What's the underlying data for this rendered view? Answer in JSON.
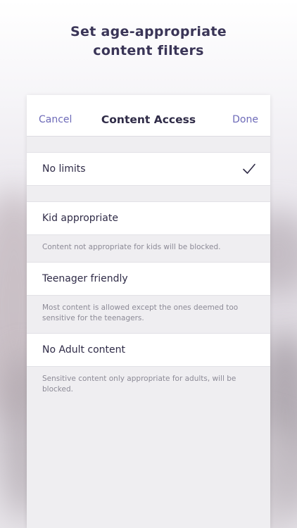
{
  "headline": {
    "line1": "Set age-appropriate",
    "line2": "content filters"
  },
  "navbar": {
    "cancel_label": "Cancel",
    "title": "Content Access",
    "done_label": "Done"
  },
  "options": [
    {
      "label": "No limits",
      "selected": true,
      "description": ""
    },
    {
      "label": "Kid appropriate",
      "selected": false,
      "description": "Content not appropriate for kids will be blocked."
    },
    {
      "label": "Teenager friendly",
      "selected": false,
      "description": "Most content is allowed except the ones deemed too sensitive for the teenagers."
    },
    {
      "label": "No Adult content",
      "selected": false,
      "description": "Sensitive content only appropriate for adults, will be blocked."
    }
  ],
  "icons": {
    "selected": "checkmark-icon"
  },
  "colors": {
    "accent": "#6d6ab8",
    "text": "#2f2b47",
    "headline": "#3a3557",
    "muted": "#8c8a96"
  }
}
